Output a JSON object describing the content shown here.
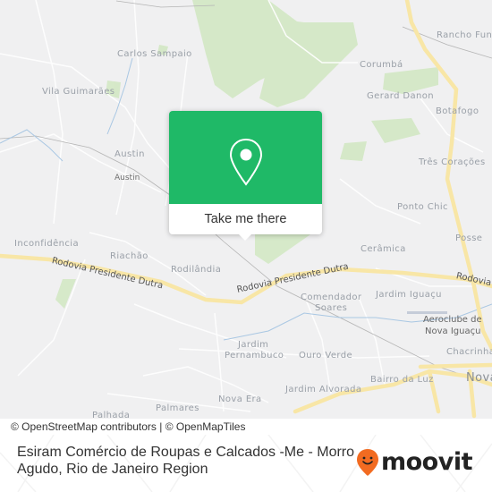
{
  "map": {
    "place_labels": [
      {
        "text": "Carlos Sampaio"
      },
      {
        "text": "Vila Guimarães"
      },
      {
        "text": "Austin"
      },
      {
        "text": "Austin"
      },
      {
        "text": "Corumbá"
      },
      {
        "text": "Gerard Danon"
      },
      {
        "text": "Rancho Fundo"
      },
      {
        "text": "Botafogo"
      },
      {
        "text": "Três Corações"
      },
      {
        "text": "Ponto Chic"
      },
      {
        "text": "Posse"
      },
      {
        "text": "Cerâmica"
      },
      {
        "text": "Inconfidência"
      },
      {
        "text": "Riachão"
      },
      {
        "text": "Rodilândia"
      },
      {
        "text": "Comendador"
      },
      {
        "text": "Soares"
      },
      {
        "text": "Jardim Iguaçu"
      },
      {
        "text": "Aeroclube de"
      },
      {
        "text": "Nova Iguaçu"
      },
      {
        "text": "Chacrinha"
      },
      {
        "text": "Jardim"
      },
      {
        "text": "Pernambuco"
      },
      {
        "text": "Ouro Verde"
      },
      {
        "text": "Bairro da Luz"
      },
      {
        "text": "Nova"
      },
      {
        "text": "Jardim Alvorada"
      },
      {
        "text": "Nova Era"
      },
      {
        "text": "Palmares"
      },
      {
        "text": "Palhada"
      }
    ],
    "road_labels": [
      {
        "text": "Rodovia Presidente Dutra"
      },
      {
        "text": "Rodovia Presidente Dutra"
      },
      {
        "text": "Rodovia"
      }
    ],
    "popup": {
      "button_label": "Take me there",
      "color": "#1fb967"
    },
    "attribution": "© OpenStreetMap contributors | © OpenMapTiles"
  },
  "footer": {
    "title": "Esiram Comércio de Roupas e Calcados -Me - Morro Agudo, Rio de Janeiro Region",
    "logo_text": "moovit",
    "logo_color": "#f26b21"
  }
}
